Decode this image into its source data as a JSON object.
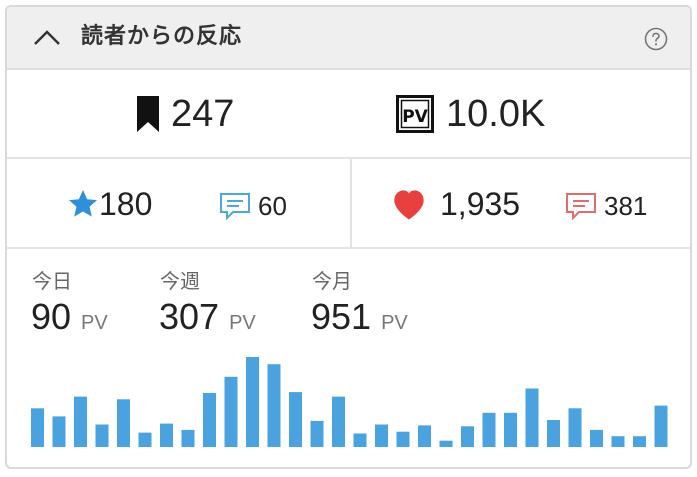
{
  "header": {
    "title": "読者からの反応",
    "collapse_icon": "chevron-up-icon",
    "help_icon": "question-circle-icon"
  },
  "stats": {
    "bookmarks": "247",
    "pageviews_total": "10.0K",
    "stars": "180",
    "star_comments": "60",
    "likes": "1,935",
    "like_comments": "381"
  },
  "period_pv": {
    "today": {
      "label": "今日",
      "value": "90",
      "unit": "PV"
    },
    "week": {
      "label": "今週",
      "value": "307",
      "unit": "PV"
    },
    "month": {
      "label": "今月",
      "value": "951",
      "unit": "PV"
    }
  },
  "colors": {
    "accent_blue": "#2f8fd8",
    "bar_blue": "#4aa3df",
    "heart_red": "#e8403f",
    "comment_blue": "#4ea7dc",
    "comment_red": "#e06c6c"
  },
  "chart_data": {
    "type": "bar",
    "ylim": [
      0,
      100
    ],
    "values": [
      43,
      34,
      56,
      25,
      53,
      16,
      26,
      19,
      60,
      78,
      100,
      92,
      61,
      29,
      56,
      15,
      25,
      17,
      24,
      7,
      23,
      38,
      38,
      65,
      30,
      43,
      19,
      12,
      12,
      46
    ]
  }
}
